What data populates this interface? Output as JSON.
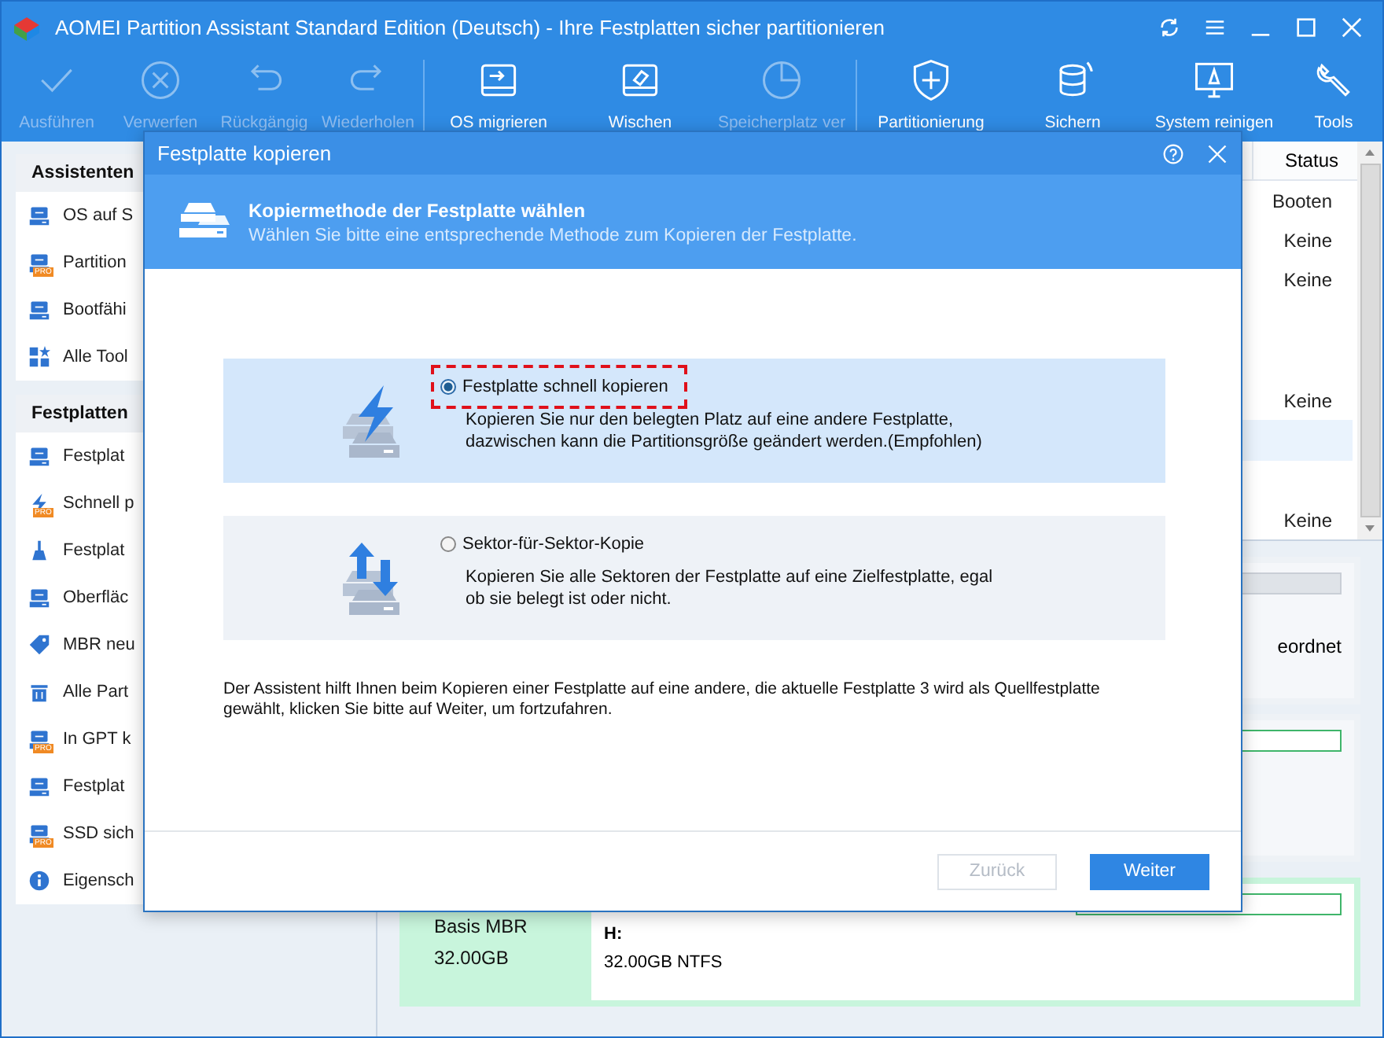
{
  "window": {
    "title": "AOMEI Partition Assistant Standard Edition (Deutsch) - Ihre Festplatten sicher partitionieren"
  },
  "toolbar": [
    {
      "label": "Ausführen",
      "disabled": true
    },
    {
      "label": "Verwerfen",
      "disabled": true
    },
    {
      "label": "Rückgängig",
      "disabled": true
    },
    {
      "label": "Wiederholen",
      "disabled": true
    },
    {
      "label": "OS migrieren",
      "disabled": false
    },
    {
      "label": "Wischen",
      "disabled": false
    },
    {
      "label": "Speicherplatz ver",
      "disabled": true
    },
    {
      "label": "Partitionierung",
      "disabled": false
    },
    {
      "label": "Sichern",
      "disabled": false
    },
    {
      "label": "System reinigen",
      "disabled": false
    },
    {
      "label": "Tools",
      "disabled": false
    }
  ],
  "sidebar": {
    "sections": [
      {
        "title": "Assistenten",
        "items": [
          {
            "label": "OS auf S"
          },
          {
            "label": "Partition",
            "badge": "PRO"
          },
          {
            "label": "Bootfähi"
          },
          {
            "label": "Alle Tool"
          }
        ]
      },
      {
        "title": "Festplatten",
        "items": [
          {
            "label": "Festplat"
          },
          {
            "label": "Schnell p",
            "badge": "PRO"
          },
          {
            "label": "Festplat"
          },
          {
            "label": "Oberfläc"
          },
          {
            "label": "MBR neu"
          },
          {
            "label": "Alle Part"
          },
          {
            "label": "In GPT k",
            "badge": "PRO"
          },
          {
            "label": "Festplat"
          },
          {
            "label": "SSD sich",
            "badge": "PRO"
          },
          {
            "label": "Eigensch"
          }
        ]
      }
    ]
  },
  "table": {
    "columns": [
      "Status"
    ],
    "rows": [
      {
        "status": "Booten",
        "selected": false
      },
      {
        "status": "Keine",
        "selected": false
      },
      {
        "status": "Keine",
        "selected": false
      },
      {
        "selected": false
      },
      {
        "selected": false
      },
      {
        "status": "Keine",
        "selected": false
      },
      {
        "selected": true
      },
      {
        "selected": false
      },
      {
        "status": "Keine",
        "selected": false
      }
    ]
  },
  "disks": [
    {
      "note": "eordnet",
      "selected": false
    },
    {
      "selected": false
    },
    {
      "type": "Basis MBR",
      "size": "32.00GB",
      "partition": "H:",
      "partition_info": "32.00GB NTFS",
      "selected": true
    }
  ],
  "dialog": {
    "title": "Festplatte kopieren",
    "heading": "Kopiermethode der Festplatte wählen",
    "subheading": "Wählen Sie bitte eine entsprechende Methode zum Kopieren der Festplatte.",
    "options": [
      {
        "label": "Festplatte schnell kopieren",
        "description": "Kopieren Sie nur den belegten Platz auf eine andere Festplatte, dazwischen kann die Partitionsgröße geändert werden.(Empfohlen)",
        "selected": true,
        "highlighted": true
      },
      {
        "label": "Sektor-für-Sektor-Kopie",
        "description": "Kopieren Sie alle Sektoren der Festplatte auf eine Zielfestplatte, egal ob sie belegt ist oder nicht.",
        "selected": false,
        "highlighted": false
      }
    ],
    "note": "Der Assistent hilft Ihnen beim Kopieren einer Festplatte auf eine andere, die aktuelle Festplatte 3 wird als Quellfestplatte gewählt, klicken Sie bitte auf Weiter, um fortzufahren.",
    "buttons": [
      {
        "label": "Zurück",
        "kind": "default",
        "disabled": true
      },
      {
        "label": "Weiter",
        "kind": "primary",
        "disabled": false
      }
    ]
  }
}
